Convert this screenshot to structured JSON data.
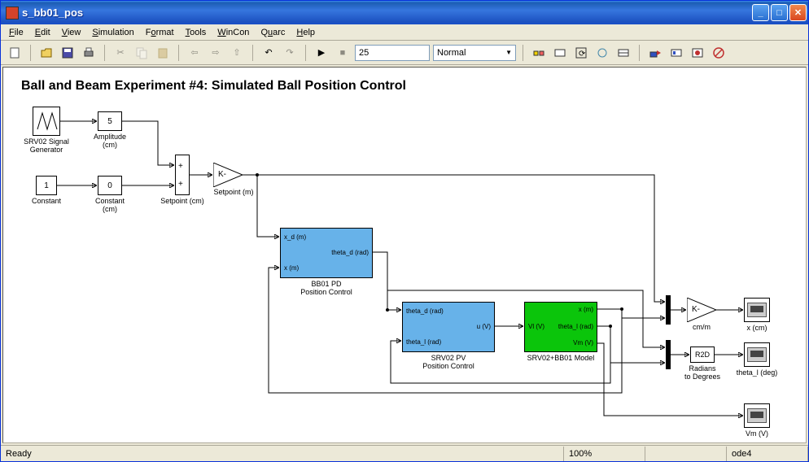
{
  "window": {
    "title": "s_bb01_pos"
  },
  "menu": {
    "file": "File",
    "edit": "Edit",
    "view": "View",
    "simulation": "Simulation",
    "format": "Format",
    "tools": "Tools",
    "wincon": "WinCon",
    "quarc": "Quarc",
    "help": "Help"
  },
  "toolbar": {
    "sim_time": "25",
    "mode": "Normal"
  },
  "diagram": {
    "title": "Ball and Beam Experiment #4: Simulated Ball Position Control",
    "sig_gen_label": "SRV02 Signal\nGenerator",
    "amplitude_val": "5",
    "amplitude_label": "Amplitude\n(cm)",
    "constant1_val": "1",
    "constant1_label": "Constant",
    "constant2_val": "0",
    "constant2_label": "Constant\n(cm)",
    "sum_label": "Setpoint (cm)",
    "gain1_text": "K-",
    "gain1_label": "Setpoint (m)",
    "bb01_label": "BB01 PD\nPosition Control",
    "bb01_in1": "x_d (m)",
    "bb01_in2": "x (m)",
    "bb01_out": "theta_d (rad)",
    "srv02_label": "SRV02 PV\nPosition Control",
    "srv02_in1": "theta_d (rad)",
    "srv02_in2": "theta_l (rad)",
    "srv02_out": "u (V)",
    "model_label": "SRV02+BB01 Model",
    "model_in": "Vl (V)",
    "model_out1": "x (m)",
    "model_out2": "theta_l (rad)",
    "model_out3": "Vm (V)",
    "gain2_text": "K-",
    "gain2_label": "cm/m",
    "r2d_text": "R2D",
    "r2d_label": "Radians\nto Degrees",
    "scope1_label": "x (cm)",
    "scope2_label": "theta_l (deg)",
    "scope3_label": "Vm (V)"
  },
  "status": {
    "ready": "Ready",
    "zoom": "100%",
    "solver": "ode4"
  }
}
